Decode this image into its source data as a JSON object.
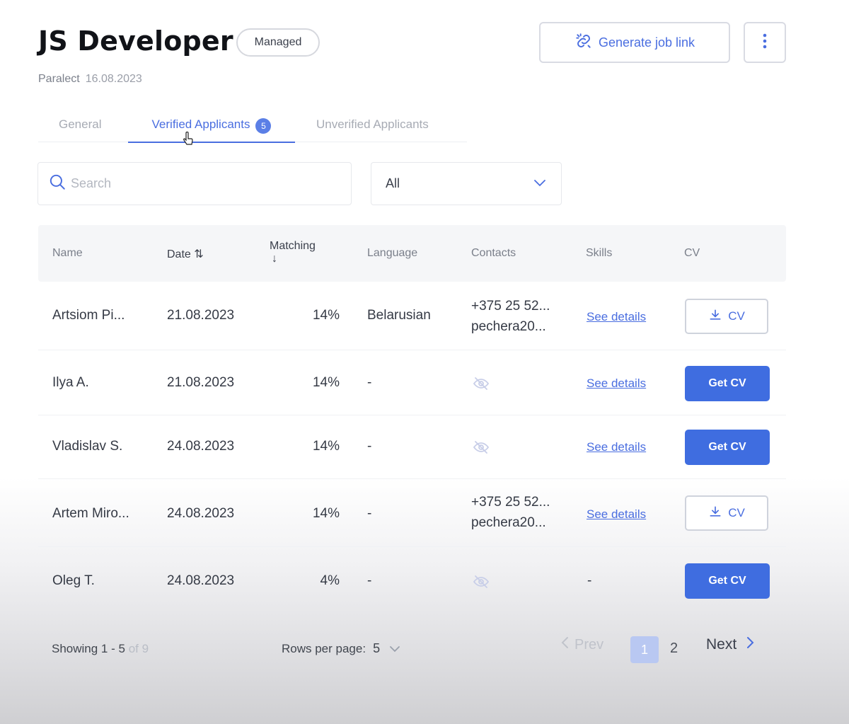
{
  "header": {
    "title": "JS Developer",
    "badge": "Managed",
    "company": "Paralect",
    "date": "16.08.2023",
    "generate_button": "Generate job link"
  },
  "tabs": [
    {
      "label": "General"
    },
    {
      "label": "Verified Applicants",
      "count": "5"
    },
    {
      "label": "Unverified Applicants"
    }
  ],
  "filters": {
    "search_placeholder": "Search",
    "select_value": "All"
  },
  "table": {
    "headers": {
      "name": "Name",
      "date": "Date ⇅",
      "matching": "Matching",
      "matching_arrow": "↓",
      "language": "Language",
      "contacts": "Contacts",
      "skills": "Skills",
      "cv": "CV"
    },
    "rows": [
      {
        "name": "Artsiom Pi...",
        "date": "21.08.2023",
        "matching": "14%",
        "language": "Belarusian",
        "phone": "+375 25 52...",
        "email": "pechera20...",
        "skills": "See details",
        "cv": "CV"
      },
      {
        "name": "Ilya A.",
        "date": "21.08.2023",
        "matching": "14%",
        "language": "-",
        "phone": "",
        "email": "",
        "skills": "See details",
        "cv": "Get CV"
      },
      {
        "name": "Vladislav S.",
        "date": "24.08.2023",
        "matching": "14%",
        "language": "-",
        "phone": "",
        "email": "",
        "skills": "See details",
        "cv": "Get CV"
      },
      {
        "name": "Artem Miro...",
        "date": "24.08.2023",
        "matching": "14%",
        "language": "-",
        "phone": "+375 25 52...",
        "email": "pechera20...",
        "skills": "See details",
        "cv": "CV"
      },
      {
        "name": "Oleg T.",
        "date": "24.08.2023",
        "matching": "4%",
        "language": "-",
        "phone": "",
        "email": "",
        "skills": "-",
        "cv": "Get CV"
      }
    ]
  },
  "footer": {
    "showing_prefix": "Showing 1 - 5",
    "showing_suffix": "of 9",
    "rows_per_page_label": "Rows per page:",
    "rows_per_page_value": "5",
    "prev": "Prev",
    "pages": [
      "1",
      "2"
    ],
    "next": "Next"
  },
  "colors": {
    "accent": "#3f6de0",
    "link": "#4a6ee0"
  },
  "icons": [
    "link-icon",
    "kebab-icon",
    "search-icon",
    "chevron-down-icon",
    "download-icon",
    "eye-off-icon",
    "chevron-left-icon",
    "chevron-right-icon",
    "cursor-icon"
  ]
}
